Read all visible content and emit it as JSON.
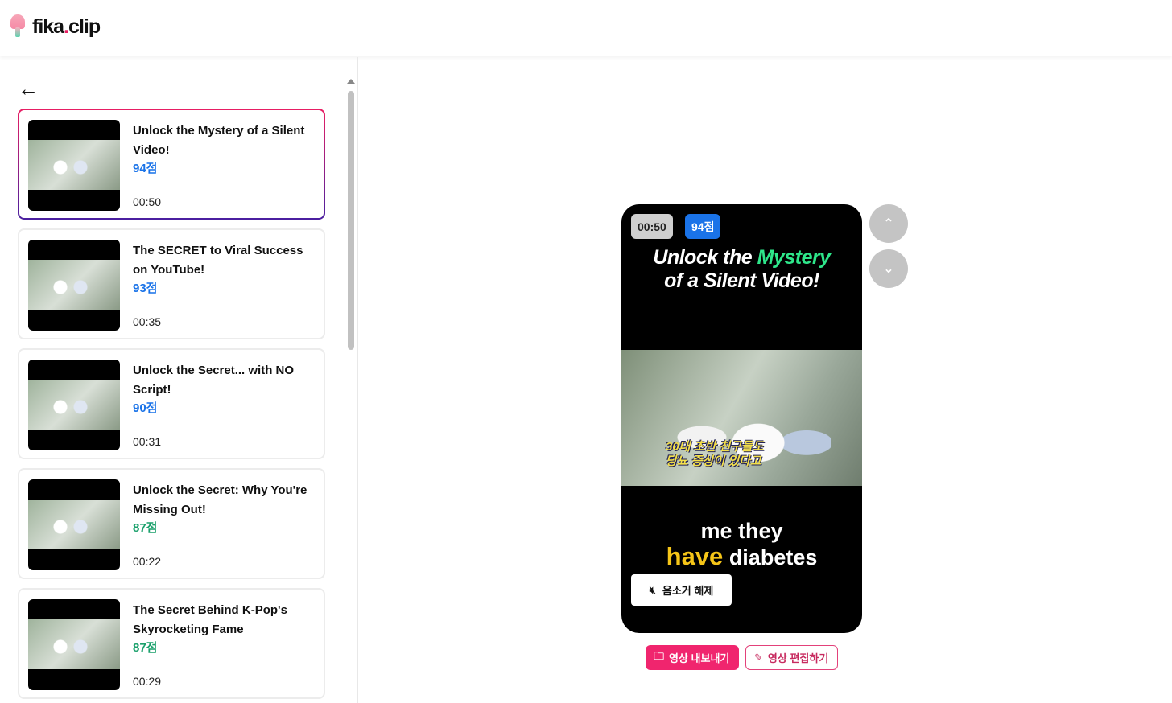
{
  "header": {
    "logo_main": "fika",
    "logo_dot": ".",
    "logo_tail": "clip"
  },
  "sidebar": {
    "back_icon": "arrow-left-icon",
    "clips": [
      {
        "title": "Unlock the Mystery of a Silent Video!",
        "score": "94점",
        "duration": "00:50",
        "score_color": "#1a73e8",
        "selected": true
      },
      {
        "title": "The SECRET to Viral Success on YouTube!",
        "score": "93점",
        "duration": "00:35",
        "score_color": "#1a73e8"
      },
      {
        "title": "Unlock the Secret... with NO Script!",
        "score": "90점",
        "duration": "00:31",
        "score_color": "#1a73e8"
      },
      {
        "title": "Unlock the Secret: Why You're Missing Out!",
        "score": "87점",
        "duration": "00:22",
        "score_color": "#1aa06b"
      },
      {
        "title": "The Secret Behind K-Pop's Skyrocketing Fame",
        "score": "87점",
        "duration": "00:29",
        "score_color": "#1aa06b"
      }
    ]
  },
  "player": {
    "duration": "00:50",
    "score": "94점",
    "title_a": "Unlock the ",
    "title_hl": "Mystery",
    "title_b": "of a Silent Video!",
    "frame_subtitle_1": "30대 초반 친구들도",
    "frame_subtitle_2": "당뇨 증상이 있다고",
    "caption_1": "me they",
    "caption_hl": "have",
    "caption_2": " diabetes",
    "unmute_label": "음소거 해제"
  },
  "actions": {
    "export_label": "영상 내보내기",
    "edit_label": "영상 편집하기"
  },
  "colors": {
    "accent": "#f0256e",
    "score_blue": "#1a73e8",
    "highlight_green": "#2ee68a",
    "caption_yellow": "#f5c518"
  }
}
